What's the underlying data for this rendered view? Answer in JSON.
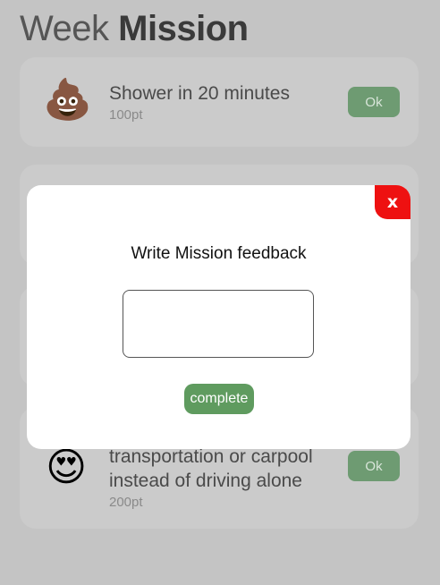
{
  "header": {
    "title_light": "Week",
    "title_bold": "Mission"
  },
  "missions": [
    {
      "emoji": "💩",
      "emoji_icon": "poop-icon",
      "title": "Shower in 20 minutes",
      "points": "100pt",
      "button": "Ok"
    },
    {
      "emoji": "😍",
      "emoji_icon": "heart-eyes-icon",
      "title": "transportation or carpool instead of driving alone",
      "points": "200pt",
      "button": "Ok"
    }
  ],
  "modal": {
    "close_label": "x",
    "title": "Write Mission feedback",
    "input_value": "",
    "submit_label": "complete"
  },
  "colors": {
    "close": "#ee1111",
    "complete": "#5f9b5f",
    "ok": "#6e9b72"
  }
}
